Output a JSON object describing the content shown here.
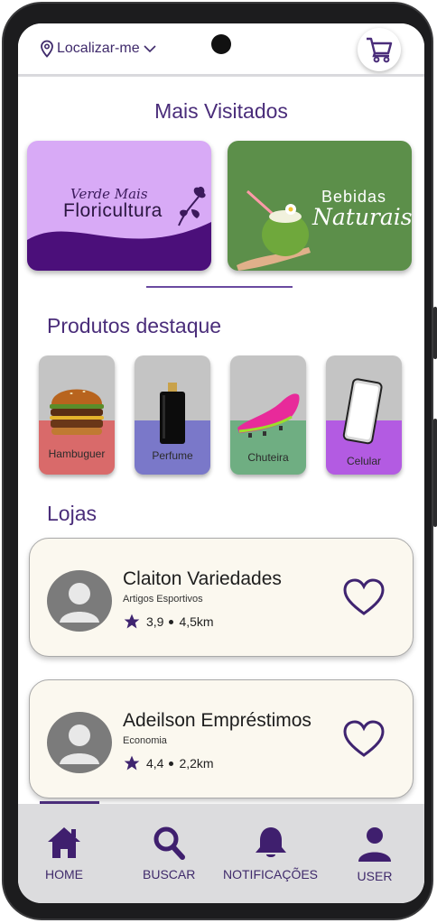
{
  "header": {
    "location_label": "Localizar-me",
    "location_icon": "map-pin-icon",
    "cart_icon": "cart-icon"
  },
  "most_visited": {
    "title": "Mais Visitados",
    "banners": [
      {
        "script": "Verde Mais",
        "name": "Floricultura"
      },
      {
        "name": "Bebidas",
        "script": "Naturais"
      }
    ]
  },
  "featured": {
    "title": "Produtos destaque",
    "products": [
      {
        "label": "Hambuguer",
        "color": "#d96a6a"
      },
      {
        "label": "Perfume",
        "color": "#7a78c9"
      },
      {
        "label": "Chuteira",
        "color": "#6fae82"
      },
      {
        "label": "Celular",
        "color": "#b35be2"
      }
    ]
  },
  "stores": {
    "title": "Lojas",
    "items": [
      {
        "name": "Claiton Variedades",
        "category": "Artigos Esportivos",
        "rating": "3,9",
        "distance": "4,5km"
      },
      {
        "name": "Adeilson Empréstimos",
        "category": "Economia",
        "rating": "4,4",
        "distance": "2,2km"
      }
    ]
  },
  "nav": {
    "items": [
      {
        "label": "HOME",
        "icon": "home-icon"
      },
      {
        "label": "BUSCAR",
        "icon": "search-icon"
      },
      {
        "label": "NOTIFICAÇÕES",
        "icon": "bell-icon"
      },
      {
        "label": "USER",
        "icon": "user-icon"
      }
    ]
  },
  "colors": {
    "primary": "#4a2d7a",
    "card_bg": "#fbf8ef",
    "nav_bg": "#dcdcde"
  }
}
